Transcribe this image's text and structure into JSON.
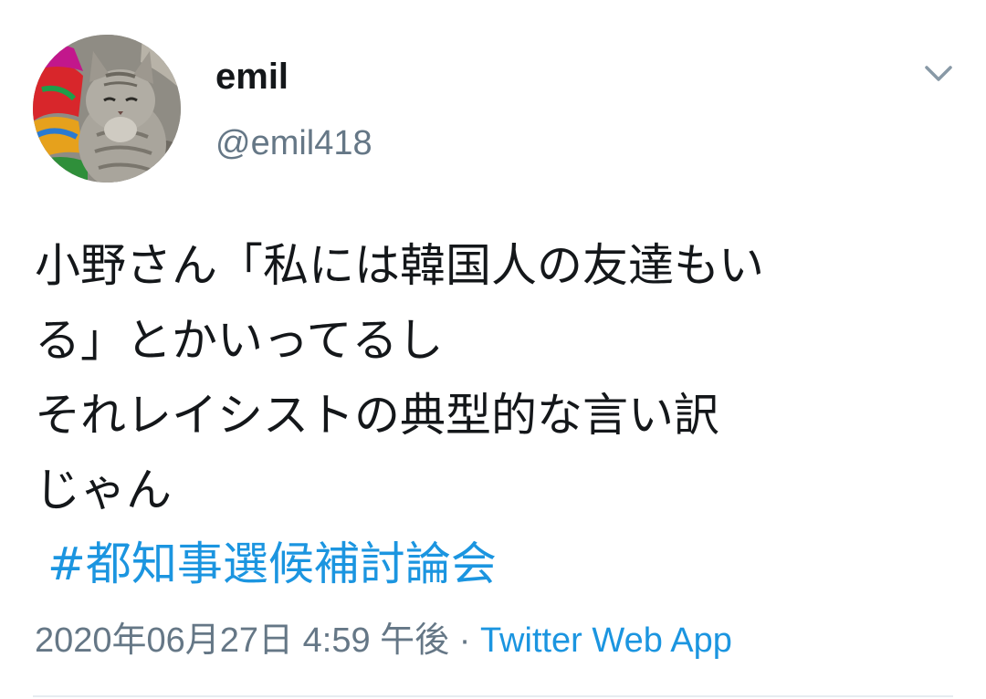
{
  "tweet": {
    "author": {
      "display_name": "emil",
      "handle": "@emil418",
      "avatar": "cat-avatar"
    },
    "menu_icon": "chevron-down-icon",
    "text_lines": [
      "小野さん「私には韓国人の友達もい",
      "る」とかいってるし",
      "それレイシストの典型的な言い訳",
      "じゃん"
    ],
    "hashtag": "#都知事選候補討論会",
    "timestamp": "2020年06月27日 4:59 午後",
    "separator": " · ",
    "source": "Twitter Web App"
  },
  "colors": {
    "text": "#14171a",
    "secondary": "#657786",
    "link": "#1b95e0",
    "divider": "#e6ecf0"
  }
}
